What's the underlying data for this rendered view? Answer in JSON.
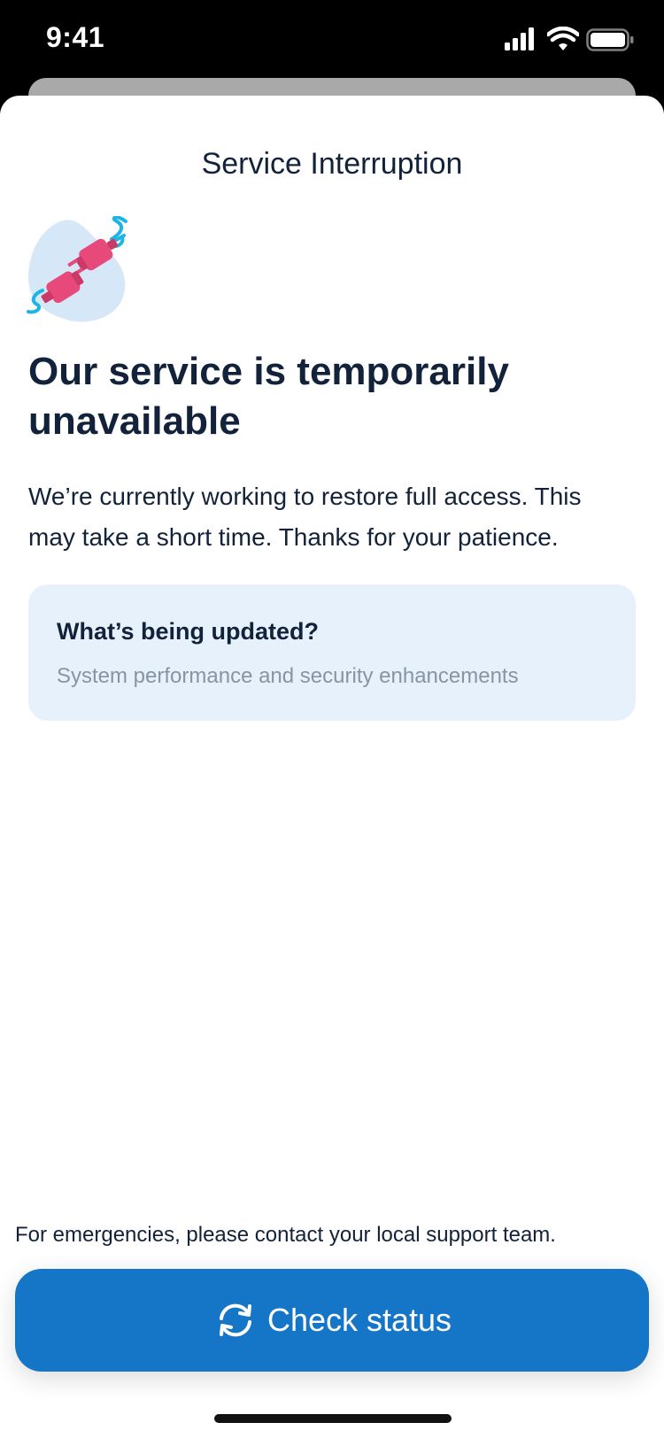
{
  "status_bar": {
    "time": "9:41"
  },
  "sheet": {
    "title": "Service Interruption"
  },
  "content": {
    "illustration_icon": "unplugged-cable-icon",
    "headline": "Our service is temporarily unavailable",
    "body": "We’re currently working to restore full access. This may take a short time. Thanks for your patience.",
    "info_card": {
      "title": "What’s being updated?",
      "subtitle": "System performance and security enhancements"
    }
  },
  "footer": {
    "note": "For emergencies, please contact your local support team.",
    "button_label": "Check status",
    "button_icon": "refresh-icon"
  },
  "colors": {
    "primary": "#1576C8",
    "card_background": "#E6F1FC",
    "text": "#13223B",
    "muted_text": "#8794A3",
    "plug": "#E6497A",
    "cable": "#1EB4E6"
  }
}
